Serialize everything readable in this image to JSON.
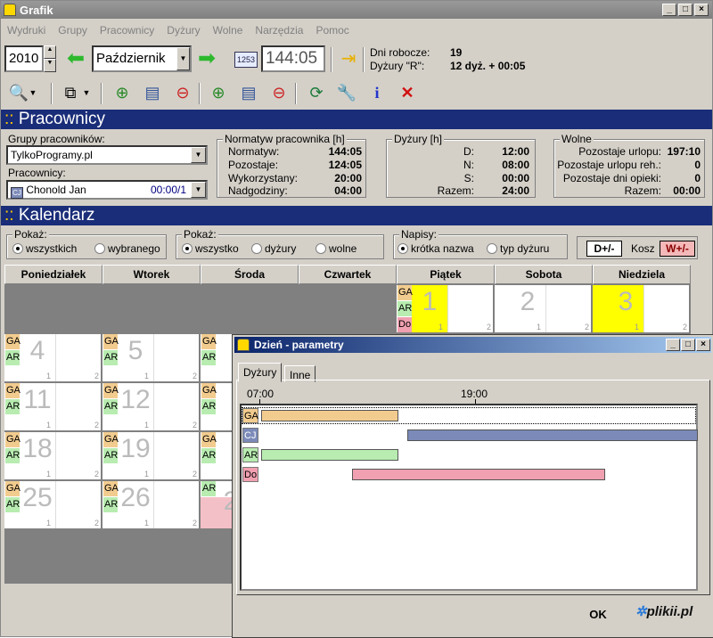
{
  "window": {
    "title": "Grafik"
  },
  "menu": [
    "Wydruki",
    "Grupy",
    "Pracownicy",
    "Dyżury",
    "Wolne",
    "Narzędzia",
    "Pomoc"
  ],
  "nav": {
    "year": "2010",
    "month": "Październik",
    "time": "144:05"
  },
  "workinfo": {
    "dni_label": "Dni robocze:",
    "dni_value": "19",
    "dyz_label": "Dyżury \"R\":",
    "dyz_value": "12 dyż. + 00:05"
  },
  "section_employees": {
    "prefix": "::",
    "title": "Pracownicy"
  },
  "groups": {
    "label": "Grupy pracowników:",
    "value": "TylkoProgramy.pl"
  },
  "employees": {
    "label": "Pracownicy:",
    "badge": "CJ",
    "name": "Chonold Jan",
    "code": "00:00/1"
  },
  "norms": {
    "title": "Normatyw pracownika [h]",
    "rows": [
      {
        "k": "Normatyw:",
        "v": "144:05"
      },
      {
        "k": "Pozostaje:",
        "v": "124:05"
      },
      {
        "k": "Wykorzystany:",
        "v": "20:00"
      },
      {
        "k": "Nadgodziny:",
        "v": "04:00"
      }
    ]
  },
  "shifts": {
    "title": "Dyżury [h]",
    "rows": [
      {
        "k": "D:",
        "v": "12:00"
      },
      {
        "k": "N:",
        "v": "08:00"
      },
      {
        "k": "S:",
        "v": "00:00"
      },
      {
        "k": "Razem:",
        "v": "24:00"
      }
    ]
  },
  "free": {
    "title": "Wolne",
    "rows": [
      {
        "k": "Pozostaje urlopu:",
        "v": "197:10"
      },
      {
        "k": "Pozostaje urlopu reh.:",
        "v": "0"
      },
      {
        "k": "Pozostaje dni opieki:",
        "v": "0"
      },
      {
        "k": "Razem:",
        "v": "00:00"
      }
    ]
  },
  "section_calendar": {
    "prefix": "::",
    "title": "Kalendarz"
  },
  "show1": {
    "title": "Pokaż:",
    "opt1": "wszystkich",
    "opt2": "wybranego"
  },
  "show2": {
    "title": "Pokaż:",
    "opt1": "wszystko",
    "opt2": "dyżury",
    "opt3": "wolne"
  },
  "captions": {
    "title": "Napisy:",
    "opt1": "krótka nazwa",
    "opt2": "typ dyżuru"
  },
  "basket": {
    "d_label": "D+/-",
    "kosz": "Kosz",
    "w_label": "W+/-"
  },
  "days": [
    "Poniedziałek",
    "Wtorek",
    "Środa",
    "Czwartek",
    "Piątek",
    "Sobota",
    "Niedziela"
  ],
  "tags": {
    "ga": "GA",
    "ar": "AR",
    "do": "Do"
  },
  "cal_nums": {
    "d1": "1",
    "d2": "2",
    "d3": "3",
    "d4": "4",
    "d5": "5",
    "d11": "11",
    "d12": "12",
    "d18": "18",
    "d19": "19",
    "d25": "25",
    "d26": "26",
    "w1": "1",
    "w2": "2",
    "w_partial": "2",
    "w_partial1": "1"
  },
  "slot": {
    "a": "1",
    "b": "2"
  },
  "dialog": {
    "title": "Dzień - parametry",
    "tab1": "Dyżury",
    "tab2": "Inne",
    "t1": "07:00",
    "t2": "19:00",
    "rows": [
      "GA",
      "CJ",
      "AR",
      "Do"
    ],
    "ok": "OK",
    "watermark": "plikii.pl"
  },
  "colors": {
    "title_blue": "#1a2d78",
    "ga": "#f2cc8f",
    "ar": "#b8ecb0",
    "do": "#f0a0b0",
    "cj": "#7b8ab8",
    "highlight": "#ffff00"
  }
}
